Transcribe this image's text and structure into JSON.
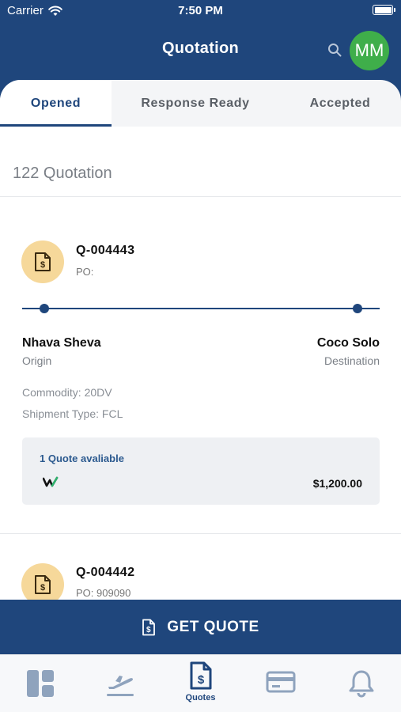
{
  "status_bar": {
    "carrier": "Carrier",
    "time": "7:50 PM"
  },
  "header": {
    "title": "Quotation",
    "avatar_initials": "MM",
    "avatar_color": "#3fae4a"
  },
  "tabs": [
    {
      "label": "Opened",
      "active": true
    },
    {
      "label": "Response Ready",
      "active": false
    },
    {
      "label": "Accepted",
      "active": false
    }
  ],
  "quotation_count": "122 Quotation",
  "quotes": [
    {
      "id": "Q-004443",
      "po": "PO:",
      "origin": "Nhava Sheva",
      "origin_label": "Origin",
      "destination": "Coco Solo",
      "destination_label": "Destination",
      "commodity": "Commodity: 20DV",
      "shipment_type": "Shipment Type: FCL",
      "quotes_available": "1 Quote avaliable",
      "price": "$1,200.00"
    },
    {
      "id": "Q-004442",
      "po": "PO: 909090"
    }
  ],
  "get_quote_label": "GET QUOTE",
  "bottom_nav": [
    {
      "icon": "dashboard-icon",
      "label": ""
    },
    {
      "icon": "flight-departure-icon",
      "label": ""
    },
    {
      "icon": "quote-document-icon",
      "label": "Quotes",
      "active": true
    },
    {
      "icon": "card-icon",
      "label": ""
    },
    {
      "icon": "bell-icon",
      "label": ""
    }
  ],
  "colors": {
    "primary": "#1f467c",
    "icon_badge": "#f6d89a",
    "inactive_nav": "#8fa3bd"
  }
}
